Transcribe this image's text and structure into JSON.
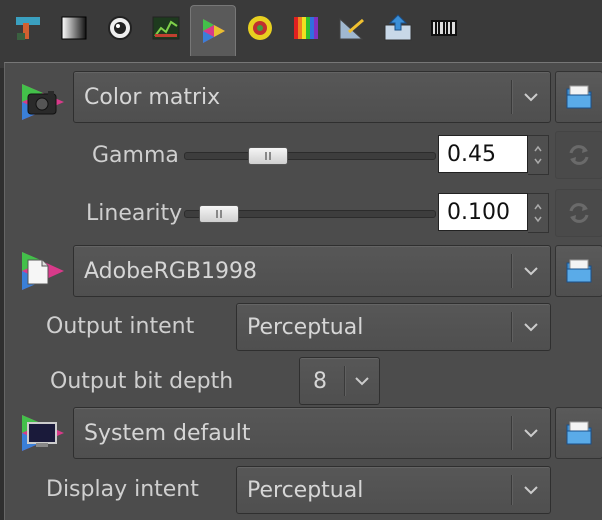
{
  "tabs": [
    {
      "icon": "tools-icon"
    },
    {
      "icon": "exposure-icon"
    },
    {
      "icon": "detail-icon"
    },
    {
      "icon": "waveform-icon"
    },
    {
      "icon": "color-management-icon",
      "active": true
    },
    {
      "icon": "color-wheel-icon"
    },
    {
      "icon": "rainbow-icon"
    },
    {
      "icon": "geometry-icon"
    },
    {
      "icon": "transform-icon"
    },
    {
      "icon": "raw-icon"
    }
  ],
  "input_profile": {
    "value": "Color matrix"
  },
  "gamma": {
    "label": "Gamma",
    "value": "0.45",
    "level": 0.3
  },
  "linearity": {
    "label": "Linearity",
    "value": "0.100",
    "level": 0.07
  },
  "working_profile": {
    "value": "AdobeRGB1998"
  },
  "output_intent": {
    "label": "Output intent",
    "value": "Perceptual"
  },
  "output_bit_depth": {
    "label": "Output bit depth",
    "value": "8"
  },
  "monitor_profile": {
    "value": "System default"
  },
  "display_intent": {
    "label": "Display intent",
    "value": "Perceptual"
  },
  "colors": {
    "panel": "#4c4c4c",
    "folder": "#4f9fd8",
    "background": "#2f2f2f"
  }
}
